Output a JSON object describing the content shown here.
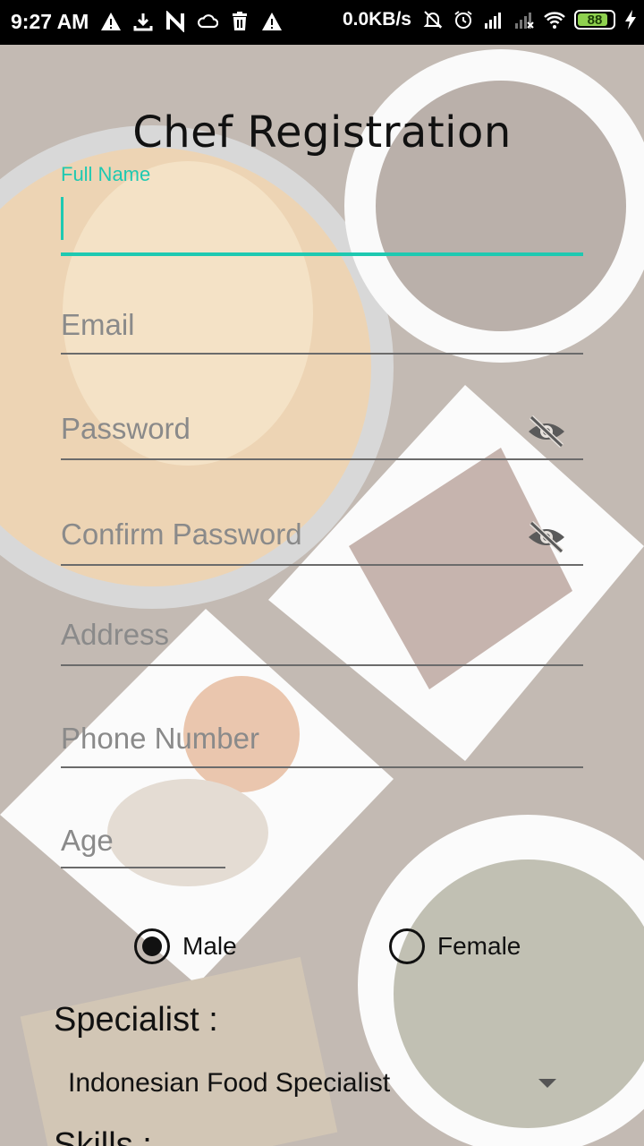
{
  "status_bar": {
    "time": "9:27 AM",
    "network_speed": "0.0KB/s",
    "battery": "88",
    "battery_level": 0.88,
    "left_icons": [
      "warning-icon",
      "download-icon",
      "n-icon",
      "cloud-icon",
      "trash-icon",
      "warning-icon"
    ],
    "right_icons": [
      "bell-off-icon",
      "alarm-icon",
      "signal-icon",
      "signal-off-icon",
      "wifi-icon",
      "battery-icon",
      "charging-icon"
    ]
  },
  "form": {
    "title": "Chef Registration",
    "full_name_label": "Full Name",
    "email_placeholder": "Email",
    "password_placeholder": "Password",
    "confirm_password_placeholder": "Confirm Password",
    "address_placeholder": "Address",
    "phone_placeholder": "Phone Number",
    "age_placeholder": "Age",
    "gender": {
      "male": "Male",
      "female": "Female",
      "selected": "Male"
    },
    "specialist_label": "Specialist :",
    "specialist_value": "Indonesian Food Specialist",
    "skills_label": "Skills :"
  },
  "colors": {
    "accent": "#1ec9b1",
    "status_bar": "#000000",
    "battery_fill": "#8fd14f"
  }
}
